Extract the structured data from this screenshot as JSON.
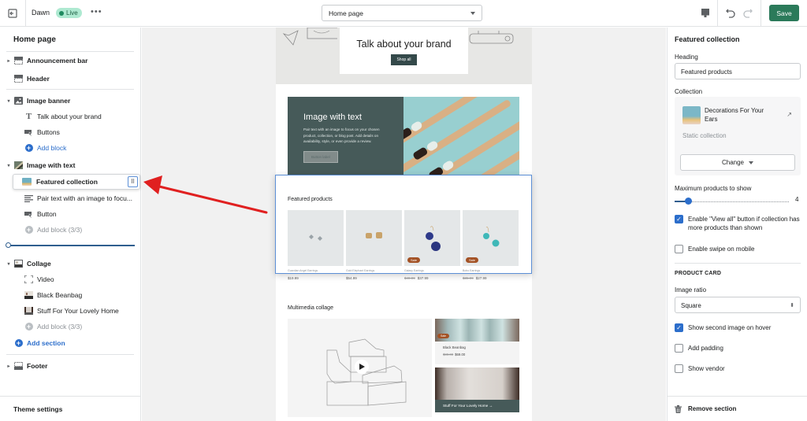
{
  "topbar": {
    "theme_name": "Dawn",
    "status_badge": "Live",
    "more_label": "•••",
    "page_selector": "Home page",
    "save_label": "Save"
  },
  "sidebar": {
    "title": "Home page",
    "items": [
      {
        "label": "Announcement bar",
        "type": "section",
        "icon": "announcement-bar-icon",
        "expandable": true,
        "expanded": false
      },
      {
        "label": "Header",
        "type": "section",
        "icon": "header-icon",
        "expandable": false
      },
      {
        "label": "Image banner",
        "type": "section",
        "icon": "image-banner-icon",
        "expandable": true,
        "expanded": true
      },
      {
        "label": "Talk about your brand",
        "type": "block",
        "icon": "text-icon"
      },
      {
        "label": "Buttons",
        "type": "block",
        "icon": "buttons-icon"
      },
      {
        "label": "Add block",
        "type": "add",
        "icon": "add-icon"
      },
      {
        "label": "Image with text",
        "type": "section",
        "icon": "image-with-text-icon",
        "expandable": true,
        "expanded": true
      },
      {
        "label": "Featured collection",
        "type": "dragging",
        "icon": "featured-collection-icon"
      },
      {
        "label": "Pair text with an image to focu...",
        "type": "block",
        "icon": "paragraph-icon"
      },
      {
        "label": "Button",
        "type": "block",
        "icon": "button-icon"
      },
      {
        "label": "Add block (3/3)",
        "type": "add-disabled",
        "icon": "add-icon"
      },
      {
        "label": "Collage",
        "type": "section",
        "icon": "collage-icon",
        "expandable": true,
        "expanded": true
      },
      {
        "label": "Video",
        "type": "block",
        "icon": "video-icon"
      },
      {
        "label": "Black Beanbag",
        "type": "block",
        "icon": "product-icon"
      },
      {
        "label": "Stuff For Your Lovely Home",
        "type": "block",
        "icon": "collection-icon"
      },
      {
        "label": "Add block (3/3)",
        "type": "add-disabled",
        "icon": "add-icon"
      },
      {
        "label": "Add section",
        "type": "add-section",
        "icon": "add-icon"
      },
      {
        "label": "Footer",
        "type": "section",
        "icon": "footer-icon",
        "expandable": true,
        "expanded": false
      }
    ],
    "theme_settings": "Theme settings"
  },
  "preview": {
    "banner": {
      "title": "Talk about your brand",
      "button": "Shop all"
    },
    "image_with_text": {
      "title": "Image with text",
      "body": "Pair text with an image to focus on your chosen product, collection, or blog post. Add details on availability, style, or even provide a review.",
      "button": "Button label"
    },
    "featured": {
      "title": "Featured products",
      "products": [
        {
          "name": "Guardian Angel Earrings",
          "price": "$19.99",
          "compare_price": "",
          "sale": false
        },
        {
          "name": "Gold Elephant Earrings",
          "price": "$54.99",
          "compare_price": "",
          "sale": false
        },
        {
          "name": "Galaxy Earrings",
          "price": "$37.99",
          "compare_price": "$49.99",
          "sale": true
        },
        {
          "name": "Boho Earrings",
          "price": "$27.99",
          "compare_price": "$35.99",
          "sale": true
        }
      ],
      "sale_label": "Sale"
    },
    "collage": {
      "title": "Multimedia collage",
      "product_name": "Black Beanbag",
      "product_price": "$69.00",
      "product_compare_price": "$80.00",
      "sale_label": "Sale",
      "collection_label": "Stuff For Your Lovely Home →"
    }
  },
  "settings": {
    "title": "Featured collection",
    "heading_label": "Heading",
    "heading_value": "Featured products",
    "collection_label": "Collection",
    "collection_name": "Decorations For Your Ears",
    "collection_type": "Static collection",
    "change_label": "Change",
    "max_products_label": "Maximum products to show",
    "max_products_value": "4",
    "max_products_fraction": 0.12,
    "view_all_label": "Enable \"View all\" button if collection has more products than shown",
    "view_all_checked": true,
    "swipe_label": "Enable swipe on mobile",
    "swipe_checked": false,
    "product_card_heading": "PRODUCT CARD",
    "image_ratio_label": "Image ratio",
    "image_ratio_value": "Square",
    "second_image_label": "Show second image on hover",
    "second_image_checked": true,
    "padding_label": "Add padding",
    "padding_checked": false,
    "vendor_label": "Show vendor",
    "vendor_checked": false,
    "remove_label": "Remove section"
  },
  "colors": {
    "accent": "#2c6ecb",
    "save": "#2b7a5a",
    "live_badge": "#aee9d1",
    "annotation_arrow": "#e02020"
  }
}
